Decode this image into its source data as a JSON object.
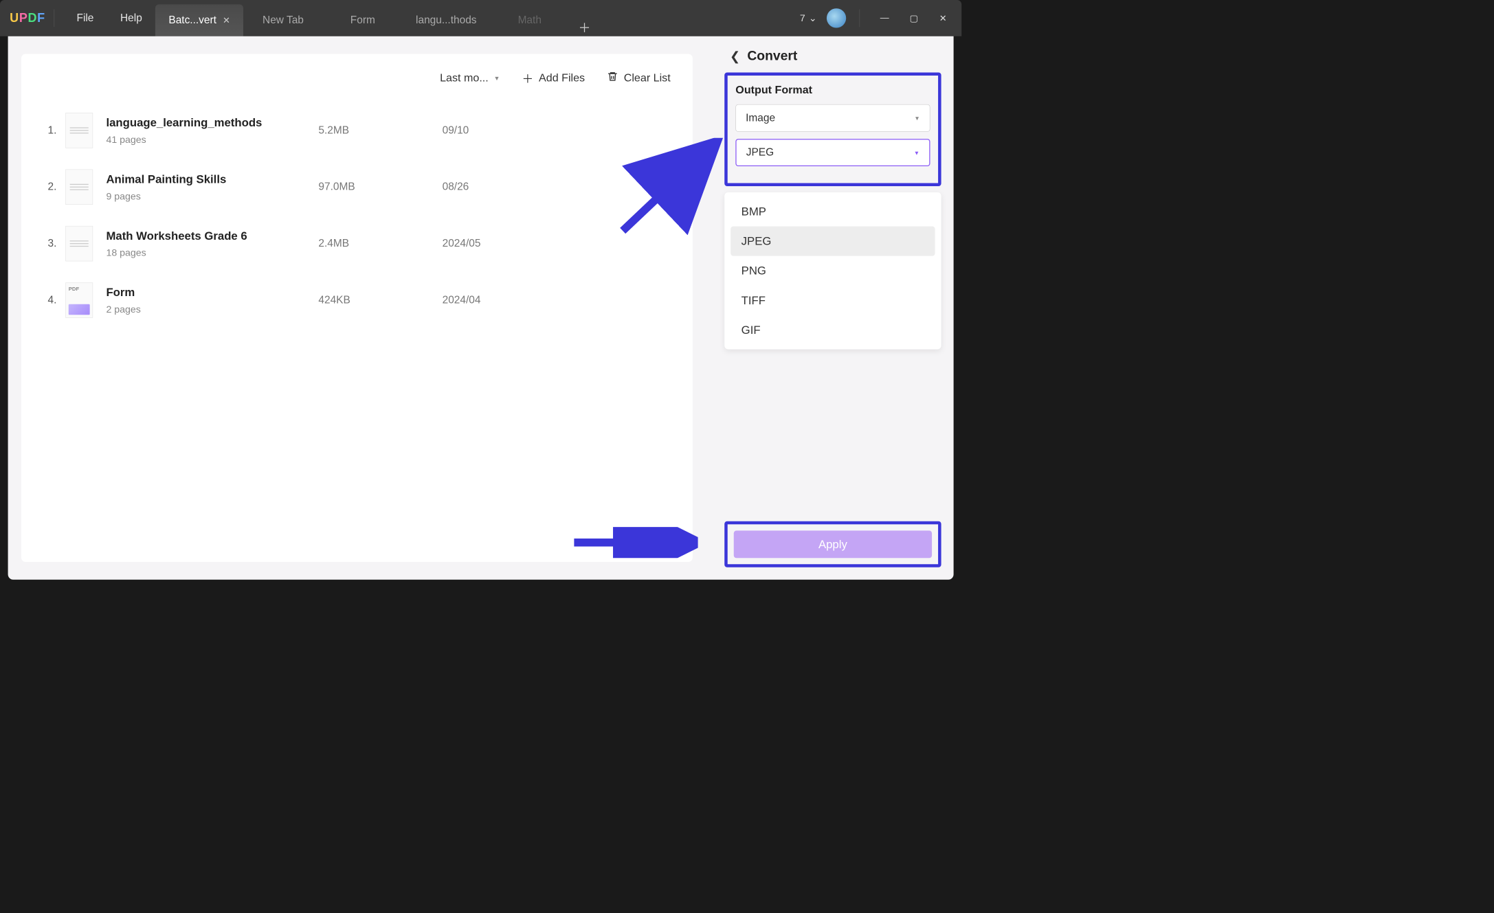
{
  "app": {
    "logo": [
      "U",
      "P",
      "D",
      "F"
    ]
  },
  "menubar": {
    "file": "File",
    "help": "Help"
  },
  "tabs": [
    {
      "label": "Batc...vert",
      "active": true,
      "closable": true
    },
    {
      "label": "New Tab",
      "active": false
    },
    {
      "label": "Form",
      "active": false
    },
    {
      "label": "langu...thods",
      "active": false
    },
    {
      "label": "Math",
      "active": false,
      "faded": true
    }
  ],
  "window": {
    "counter": "7"
  },
  "toolbar": {
    "sort_label": "Last mo...",
    "add_files": "Add Files",
    "clear_list": "Clear List"
  },
  "files": [
    {
      "idx": "1.",
      "name": "language_learning_methods",
      "pages": "41 pages",
      "size": "5.2MB",
      "date": "09/10"
    },
    {
      "idx": "2.",
      "name": "Animal Painting Skills",
      "pages": "9 pages",
      "size": "97.0MB",
      "date": "08/26"
    },
    {
      "idx": "3.",
      "name": "Math Worksheets Grade 6",
      "pages": "18 pages",
      "size": "2.4MB",
      "date": "2024/05"
    },
    {
      "idx": "4.",
      "name": "Form",
      "pages": "2 pages",
      "size": "424KB",
      "date": "2024/04"
    }
  ],
  "side": {
    "title": "Convert",
    "output_format_label": "Output Format",
    "format_category": "Image",
    "format_value": "JPEG",
    "options": [
      "BMP",
      "JPEG",
      "PNG",
      "TIFF",
      "GIF"
    ],
    "apply": "Apply"
  }
}
